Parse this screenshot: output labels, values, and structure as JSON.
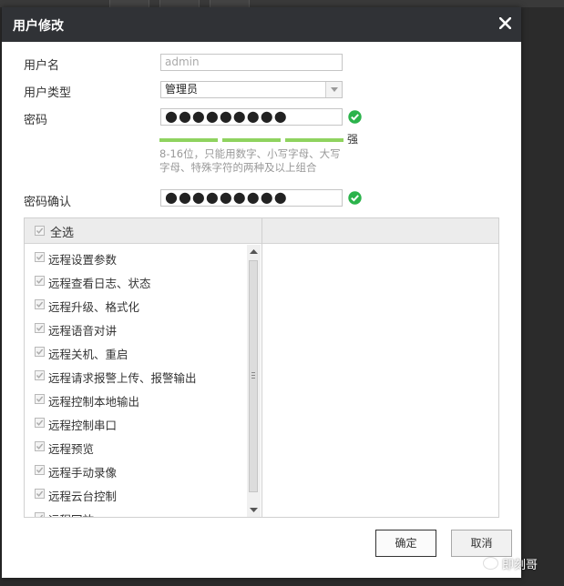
{
  "dialog": {
    "title": "用户修改",
    "close_icon": "close-icon"
  },
  "form": {
    "username_label": "用户名",
    "username_value": "admin",
    "usertype_label": "用户类型",
    "usertype_value": "管理员",
    "password_label": "密码",
    "password_value": "●●●●●●●●●",
    "strength_label": "强",
    "strength_level": 3,
    "password_hint": "8-16位，只能用数字、小写字母、大写字母、特殊字符的两种及以上组合",
    "confirm_label": "密码确认",
    "confirm_value": "●●●●●●●●●",
    "valid_icon": "check-circle-icon",
    "accent_color": "#2bb34b"
  },
  "permissions": {
    "select_all_label": "全选",
    "items": [
      {
        "label": "远程设置参数"
      },
      {
        "label": "远程查看日志、状态"
      },
      {
        "label": "远程升级、格式化"
      },
      {
        "label": "远程语音对讲"
      },
      {
        "label": "远程关机、重启"
      },
      {
        "label": "远程请求报警上传、报警输出"
      },
      {
        "label": "远程控制本地输出"
      },
      {
        "label": "远程控制串口"
      },
      {
        "label": "远程预览"
      },
      {
        "label": "远程手动录像"
      },
      {
        "label": "远程云台控制"
      },
      {
        "label": "远程回放"
      }
    ]
  },
  "buttons": {
    "ok_label": "确定",
    "cancel_label": "取消"
  },
  "watermark": {
    "text": "即刻哥"
  }
}
